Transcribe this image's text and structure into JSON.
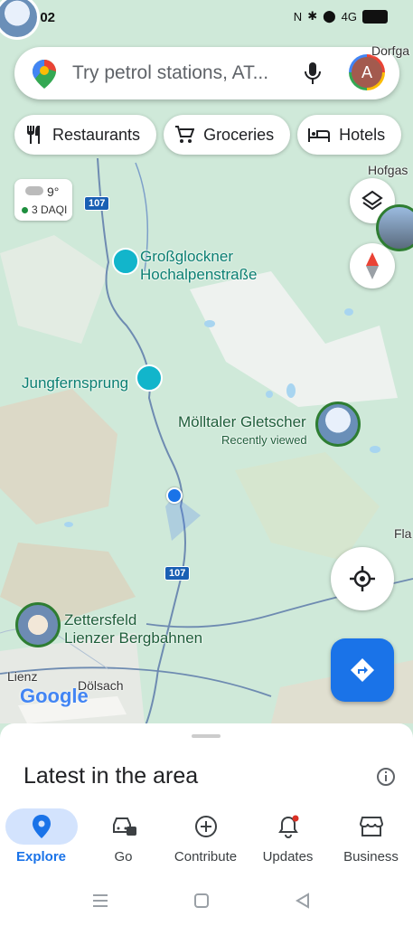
{
  "status_bar": {
    "time": "5:02",
    "network": "4G"
  },
  "search": {
    "placeholder": "Try petrol stations, AT...",
    "avatar_letter": "A"
  },
  "chips": [
    {
      "label": "Restaurants",
      "icon": "fork-knife-icon"
    },
    {
      "label": "Groceries",
      "icon": "cart-icon"
    },
    {
      "label": "Hotels",
      "icon": "bed-icon"
    }
  ],
  "weather": {
    "temp": "9°",
    "air_quality": "3 DAQI"
  },
  "map": {
    "places": {
      "grossglockner": [
        "Großglockner",
        "Hochalpenstraße"
      ],
      "jungfernsprung": "Jungfernsprung",
      "molltaler": {
        "name": "Mölltaler Gletscher",
        "note": "Recently viewed"
      },
      "zettersfeld": [
        "Zettersfeld",
        "Lienzer Bergbahnen"
      ]
    },
    "towns": {
      "lienz": "Lienz",
      "dolsach": "Dölsach",
      "hofgas": "Hofgas",
      "dorfga": "Dorfga",
      "fla": "Fla"
    },
    "road_labels": [
      "107",
      "107"
    ],
    "logo": "Google"
  },
  "sheet": {
    "title": "Latest in the area"
  },
  "bottom_nav": [
    {
      "label": "Explore",
      "icon": "location-pin-icon",
      "active": true
    },
    {
      "label": "Go",
      "icon": "car-icon",
      "active": false
    },
    {
      "label": "Contribute",
      "icon": "add-circle-icon",
      "active": false
    },
    {
      "label": "Updates",
      "icon": "bell-icon",
      "active": false
    },
    {
      "label": "Business",
      "icon": "storefront-icon",
      "active": false
    }
  ],
  "colors": {
    "accent": "#1a73e8",
    "map_green": "#cfe9d9",
    "poi_teal": "#12b5cb"
  }
}
